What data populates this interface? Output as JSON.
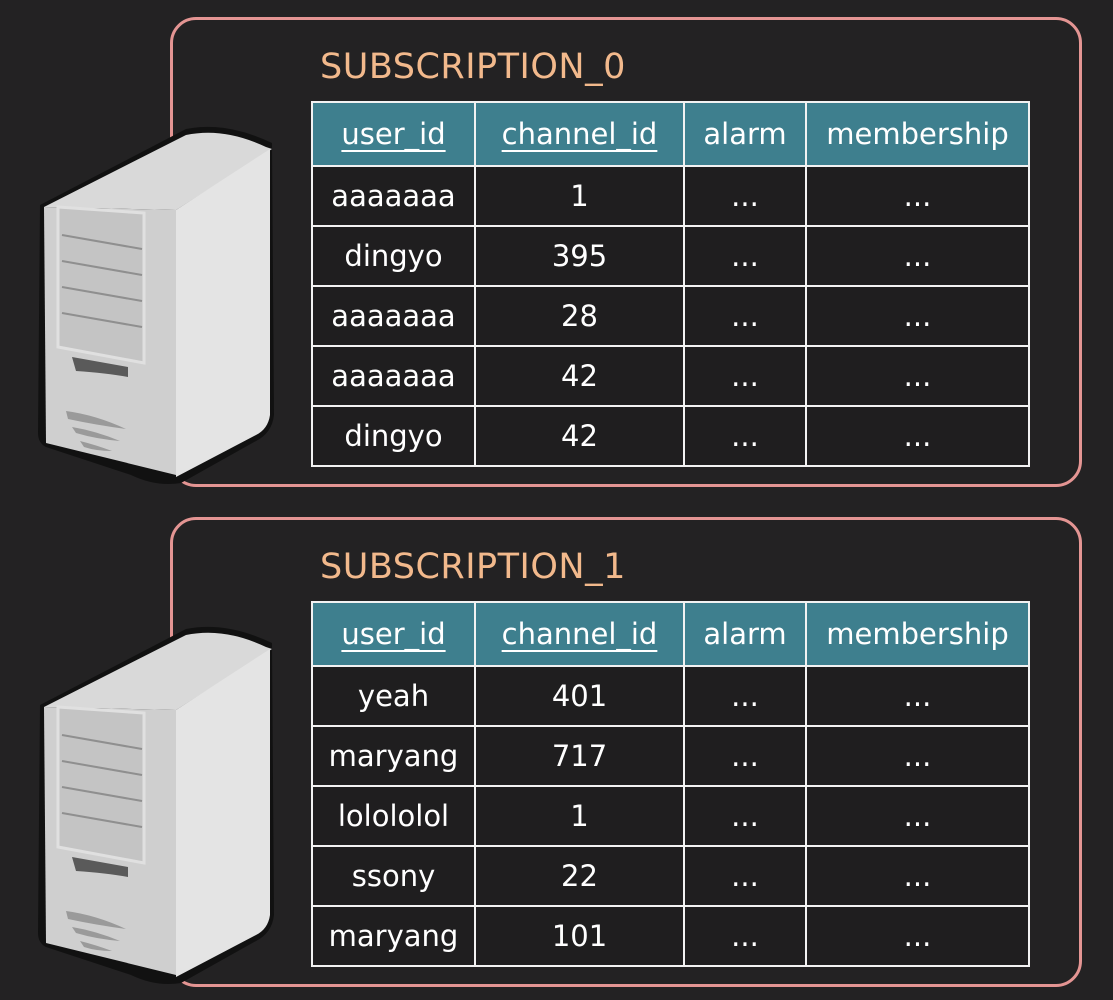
{
  "colors": {
    "background": "#232223",
    "border": "#e49593",
    "title": "#f2b98c",
    "header": "#3e7f8e"
  },
  "shards": [
    {
      "title": "SUBSCRIPTION_0",
      "icon": "server-icon",
      "columns": [
        {
          "label": "user_id",
          "key": true
        },
        {
          "label": "channel_id",
          "key": true
        },
        {
          "label": "alarm",
          "key": false
        },
        {
          "label": "membership",
          "key": false
        }
      ],
      "rows": [
        [
          "aaaaaaa",
          "1",
          "...",
          "..."
        ],
        [
          "dingyo",
          "395",
          "...",
          "..."
        ],
        [
          "aaaaaaa",
          "28",
          "...",
          "..."
        ],
        [
          "aaaaaaa",
          "42",
          "...",
          "..."
        ],
        [
          "dingyo",
          "42",
          "...",
          "..."
        ]
      ]
    },
    {
      "title": "SUBSCRIPTION_1",
      "icon": "server-icon",
      "columns": [
        {
          "label": "user_id",
          "key": true
        },
        {
          "label": "channel_id",
          "key": true
        },
        {
          "label": "alarm",
          "key": false
        },
        {
          "label": "membership",
          "key": false
        }
      ],
      "rows": [
        [
          "yeah",
          "401",
          "...",
          "..."
        ],
        [
          "maryang",
          "717",
          "...",
          "..."
        ],
        [
          "lolololol",
          "1",
          "...",
          "..."
        ],
        [
          "ssony",
          "22",
          "...",
          "..."
        ],
        [
          "maryang",
          "101",
          "...",
          "..."
        ]
      ]
    }
  ]
}
